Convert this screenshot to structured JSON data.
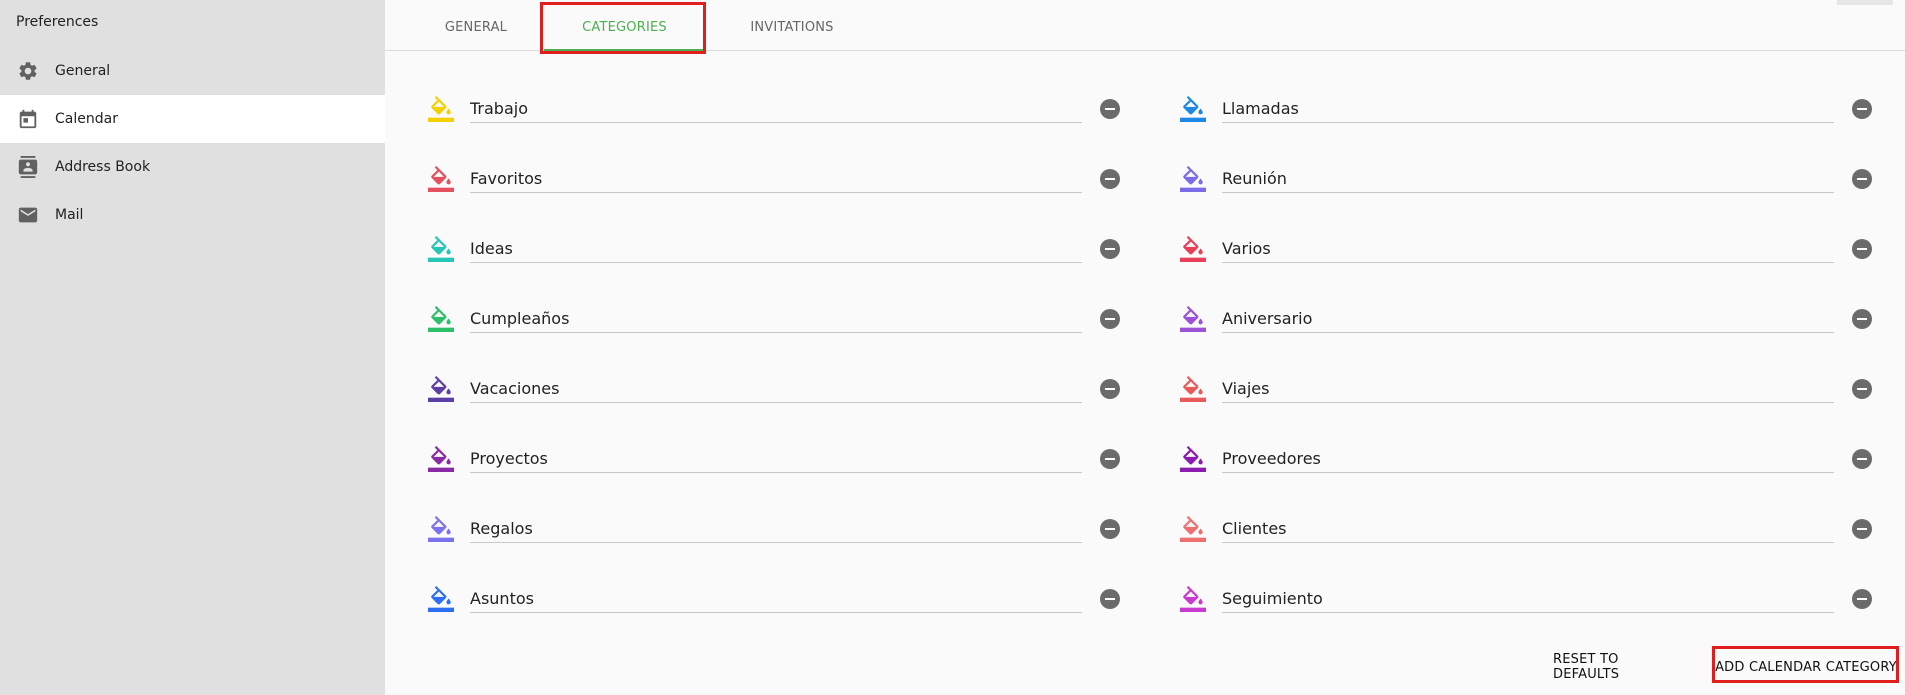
{
  "sidebar": {
    "title": "Preferences",
    "items": [
      {
        "label": "General",
        "icon": "gear-icon"
      },
      {
        "label": "Calendar",
        "icon": "calendar-icon",
        "active": true
      },
      {
        "label": "Address Book",
        "icon": "contacts-icon"
      },
      {
        "label": "Mail",
        "icon": "mail-icon"
      }
    ]
  },
  "tabs": [
    {
      "label": "GENERAL"
    },
    {
      "label": "CATEGORIES",
      "active": true
    },
    {
      "label": "INVITATIONS"
    }
  ],
  "categories": {
    "left": [
      {
        "name": "Trabajo",
        "color": "#f3d100"
      },
      {
        "name": "Favoritos",
        "color": "#e4505e"
      },
      {
        "name": "Ideas",
        "color": "#26c6b7"
      },
      {
        "name": "Cumpleaños",
        "color": "#2ebf6a"
      },
      {
        "name": "Vacaciones",
        "color": "#5b3fa6"
      },
      {
        "name": "Proyectos",
        "color": "#8a2aa5"
      },
      {
        "name": "Regalos",
        "color": "#7b72ef"
      },
      {
        "name": "Asuntos",
        "color": "#2f6df3"
      }
    ],
    "right": [
      {
        "name": "Llamadas",
        "color": "#1e88e5"
      },
      {
        "name": "Reunión",
        "color": "#7a6ce6"
      },
      {
        "name": "Varios",
        "color": "#e8405a"
      },
      {
        "name": "Aniversario",
        "color": "#9b52d6"
      },
      {
        "name": "Viajes",
        "color": "#ea5a5a"
      },
      {
        "name": "Proveedores",
        "color": "#8a1cb0"
      },
      {
        "name": "Clientes",
        "color": "#ee6f6f"
      },
      {
        "name": "Seguimiento",
        "color": "#c93ad0"
      }
    ]
  },
  "actions": {
    "reset_label": "RESET TO DEFAULTS",
    "add_label": "ADD CALENDAR CATEGORY"
  },
  "colors": {
    "accent": "#4caf50",
    "highlight": "#e01e1e"
  }
}
